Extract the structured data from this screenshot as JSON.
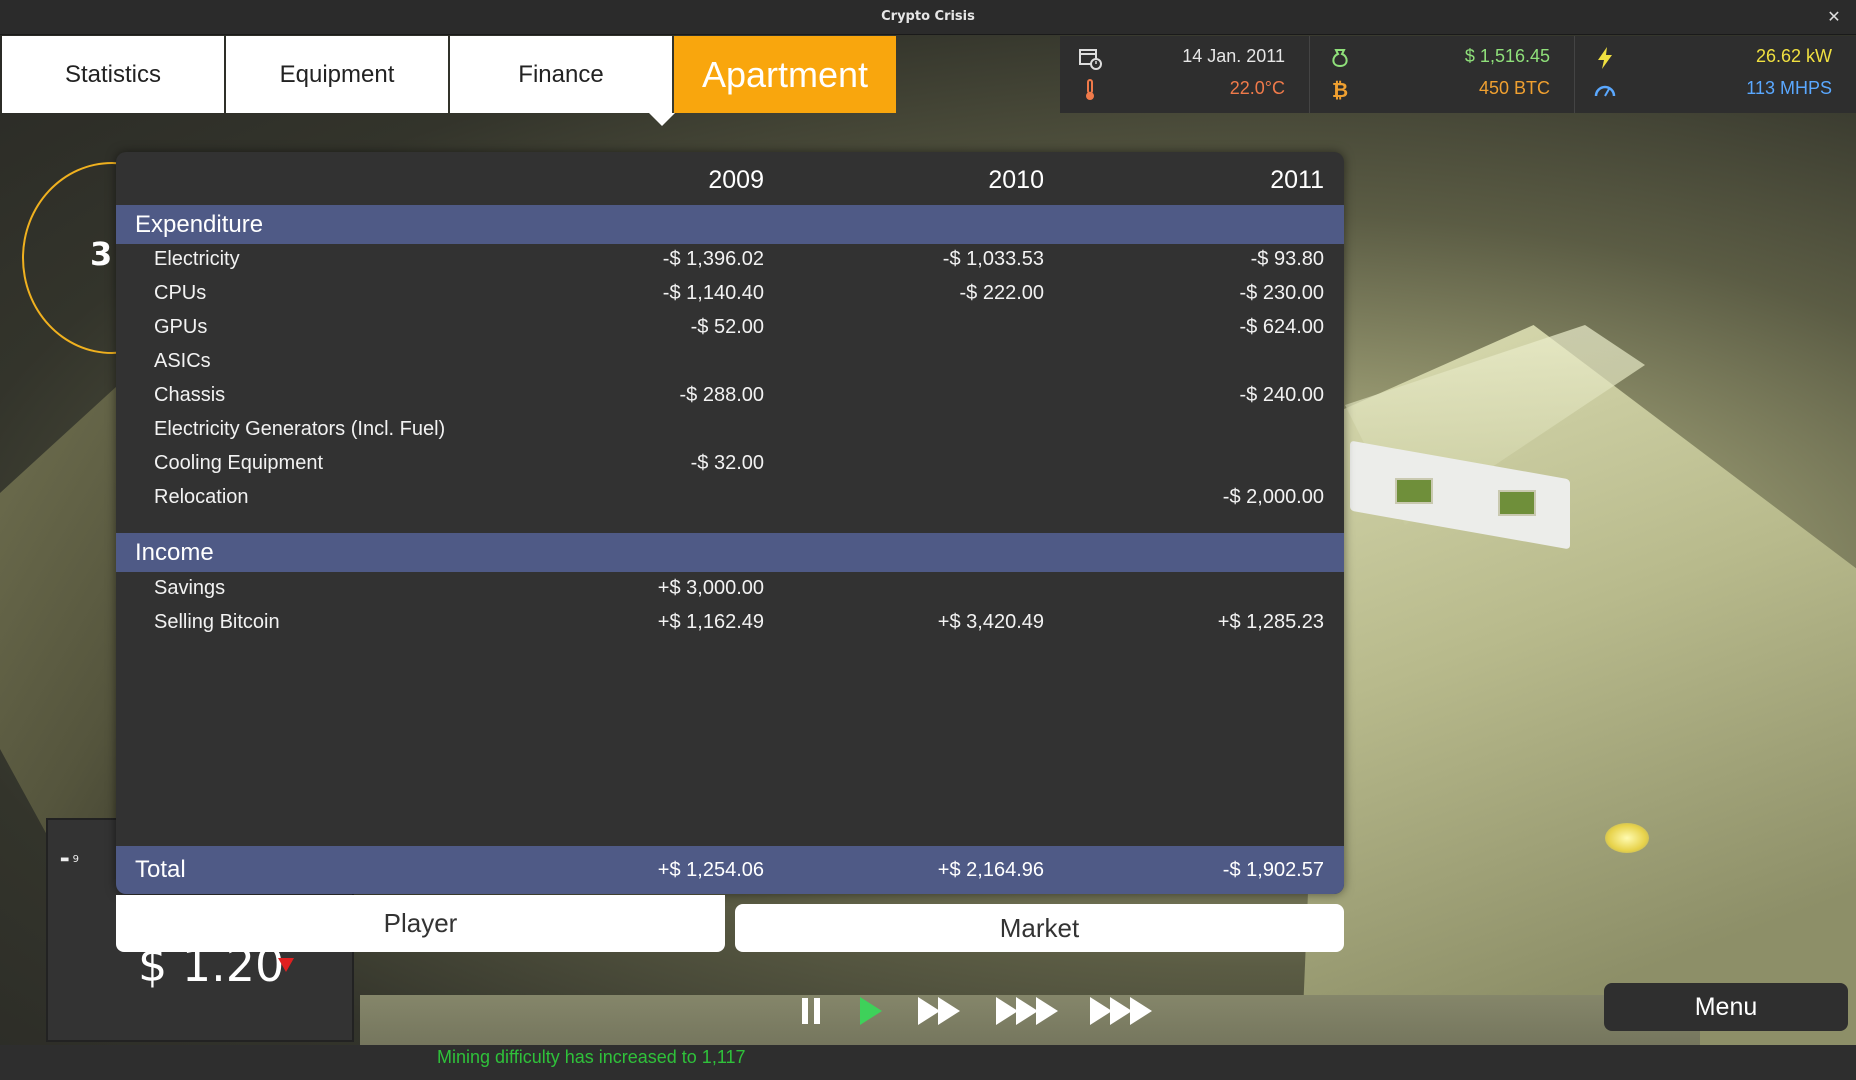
{
  "window": {
    "title": "Crypto Crisis",
    "close_label": "✕"
  },
  "tabs": [
    {
      "label": "Statistics",
      "active": false
    },
    {
      "label": "Equipment",
      "active": false
    },
    {
      "label": "Finance",
      "active": false
    },
    {
      "label": "Apartment",
      "active": true
    }
  ],
  "stats": {
    "date": "14 Jan. 2011",
    "temperature": "22.0°C",
    "money": "$ 1,516.45",
    "btc": "450 BTC",
    "power": "26.62 kW",
    "hashrate": "113 MHPS",
    "colors": {
      "date": "#e6e6e6",
      "temperature": "#f07a4a",
      "money": "#8fe07a",
      "btc": "#f0a030",
      "power": "#f0e040",
      "hashrate": "#5aa8ff"
    },
    "icons": {
      "date": "calendar-clock-icon",
      "temperature": "thermometer-icon",
      "money": "money-bag-icon",
      "btc": "bitcoin-icon",
      "power": "lightning-icon",
      "hashrate": "speedometer-icon"
    }
  },
  "background": {
    "ring_text": "3",
    "machine_label": "9",
    "machine_price": "$ 1.20"
  },
  "finance": {
    "years": [
      "2009",
      "2010",
      "2011"
    ],
    "expenditure": {
      "title": "Expenditure",
      "rows": [
        {
          "name": "Electricity",
          "v2009": "-$ 1,396.02",
          "v2010": "-$ 1,033.53",
          "v2011": "-$ 93.80"
        },
        {
          "name": "CPUs",
          "v2009": "-$ 1,140.40",
          "v2010": "-$ 222.00",
          "v2011": "-$ 230.00"
        },
        {
          "name": "GPUs",
          "v2009": "-$ 52.00",
          "v2010": "",
          "v2011": "-$ 624.00"
        },
        {
          "name": "ASICs",
          "v2009": "",
          "v2010": "",
          "v2011": ""
        },
        {
          "name": "Chassis",
          "v2009": "-$ 288.00",
          "v2010": "",
          "v2011": "-$ 240.00"
        },
        {
          "name": "Electricity Generators (Incl. Fuel)",
          "v2009": "",
          "v2010": "",
          "v2011": ""
        },
        {
          "name": "Cooling Equipment",
          "v2009": "-$ 32.00",
          "v2010": "",
          "v2011": ""
        },
        {
          "name": "Relocation",
          "v2009": "",
          "v2010": "",
          "v2011": "-$ 2,000.00"
        }
      ]
    },
    "income": {
      "title": "Income",
      "rows": [
        {
          "name": "Savings",
          "v2009": "+$ 3,000.00",
          "v2010": "",
          "v2011": ""
        },
        {
          "name": "Selling Bitcoin",
          "v2009": "+$ 1,162.49",
          "v2010": "+$ 3,420.49",
          "v2011": "+$ 1,285.23"
        }
      ]
    },
    "total": {
      "name": "Total",
      "v2009": "+$ 1,254.06",
      "v2010": "+$ 2,164.96",
      "v2011": "-$ 1,902.57"
    }
  },
  "buttons": {
    "player": "Player",
    "market": "Market",
    "menu": "Menu"
  },
  "status": {
    "message": "Mining difficulty has increased to 1,117"
  },
  "colors": {
    "accent": "#f9a60d",
    "header_band": "#4f5a86",
    "panel": "#323232",
    "status_green": "#2fc13a"
  }
}
